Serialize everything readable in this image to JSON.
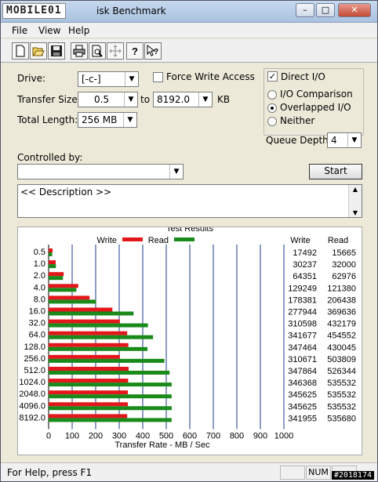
{
  "window": {
    "title": "isk Benchmark",
    "logo_text": "MOBILE01"
  },
  "menu": [
    "File",
    "View",
    "Help"
  ],
  "toolbar": [
    "new-icon",
    "open-icon",
    "save-icon",
    "print-icon",
    "print-preview-icon",
    "move-icon",
    "help-icon",
    "context-help-icon"
  ],
  "settings": {
    "drive_label": "Drive:",
    "drive_value": "[-c-]",
    "force_write_label": "Force Write Access",
    "force_write_checked": false,
    "direct_io_label": "Direct I/O",
    "direct_io_checked": true,
    "transfer_size_label": "Transfer Size:",
    "transfer_from": "0.5",
    "to_label": "to",
    "transfer_to": "8192.0",
    "kb_label": "KB",
    "total_length_label": "Total Length:",
    "total_length_value": "256 MB",
    "io_options": [
      {
        "label": "I/O Comparison",
        "selected": false
      },
      {
        "label": "Overlapped I/O",
        "selected": true
      },
      {
        "label": "Neither",
        "selected": false
      }
    ],
    "queue_depth_label": "Queue Depth:",
    "queue_depth_value": "4",
    "controlled_by_label": "Controlled by:",
    "controlled_by_value": "",
    "start_label": "Start",
    "description": "<< Description >>"
  },
  "chart_data": {
    "type": "bar",
    "title": "Test Results",
    "xlabel": "Transfer Rate - MB / Sec",
    "xlim": [
      0,
      1000
    ],
    "x_ticks": [
      0,
      100,
      200,
      300,
      400,
      500,
      600,
      700,
      800,
      900,
      1000
    ],
    "categories": [
      "0.5",
      "1.0",
      "2.0",
      "4.0",
      "8.0",
      "16.0",
      "32.0",
      "64.0",
      "128.0",
      "256.0",
      "512.0",
      "1024.0",
      "2048.0",
      "4096.0",
      "8192.0"
    ],
    "series": [
      {
        "name": "Write",
        "color": "#e3171b",
        "values": [
          17,
          30,
          64,
          126,
          174,
          271,
          303,
          334,
          339,
          303,
          340,
          338,
          337,
          337,
          334
        ],
        "raw": [
          17492,
          30237,
          64351,
          129249,
          178381,
          277944,
          310598,
          341677,
          347464,
          310671,
          347864,
          346368,
          345625,
          345625,
          341955
        ]
      },
      {
        "name": "Read",
        "color": "#1a8a1a",
        "values": [
          15,
          31,
          61,
          118,
          202,
          361,
          422,
          444,
          420,
          492,
          514,
          523,
          523,
          523,
          523
        ],
        "raw": [
          15665,
          32000,
          62976,
          121380,
          206438,
          369636,
          432179,
          454552,
          430045,
          503809,
          526344,
          535532,
          535532,
          535532,
          535680
        ]
      }
    ],
    "table_headers": [
      "Write",
      "Read"
    ],
    "legend_position": "top"
  },
  "status": {
    "help_text": "For Help, press F1",
    "num_indicator": "NUM",
    "watermark": "#2018174"
  }
}
